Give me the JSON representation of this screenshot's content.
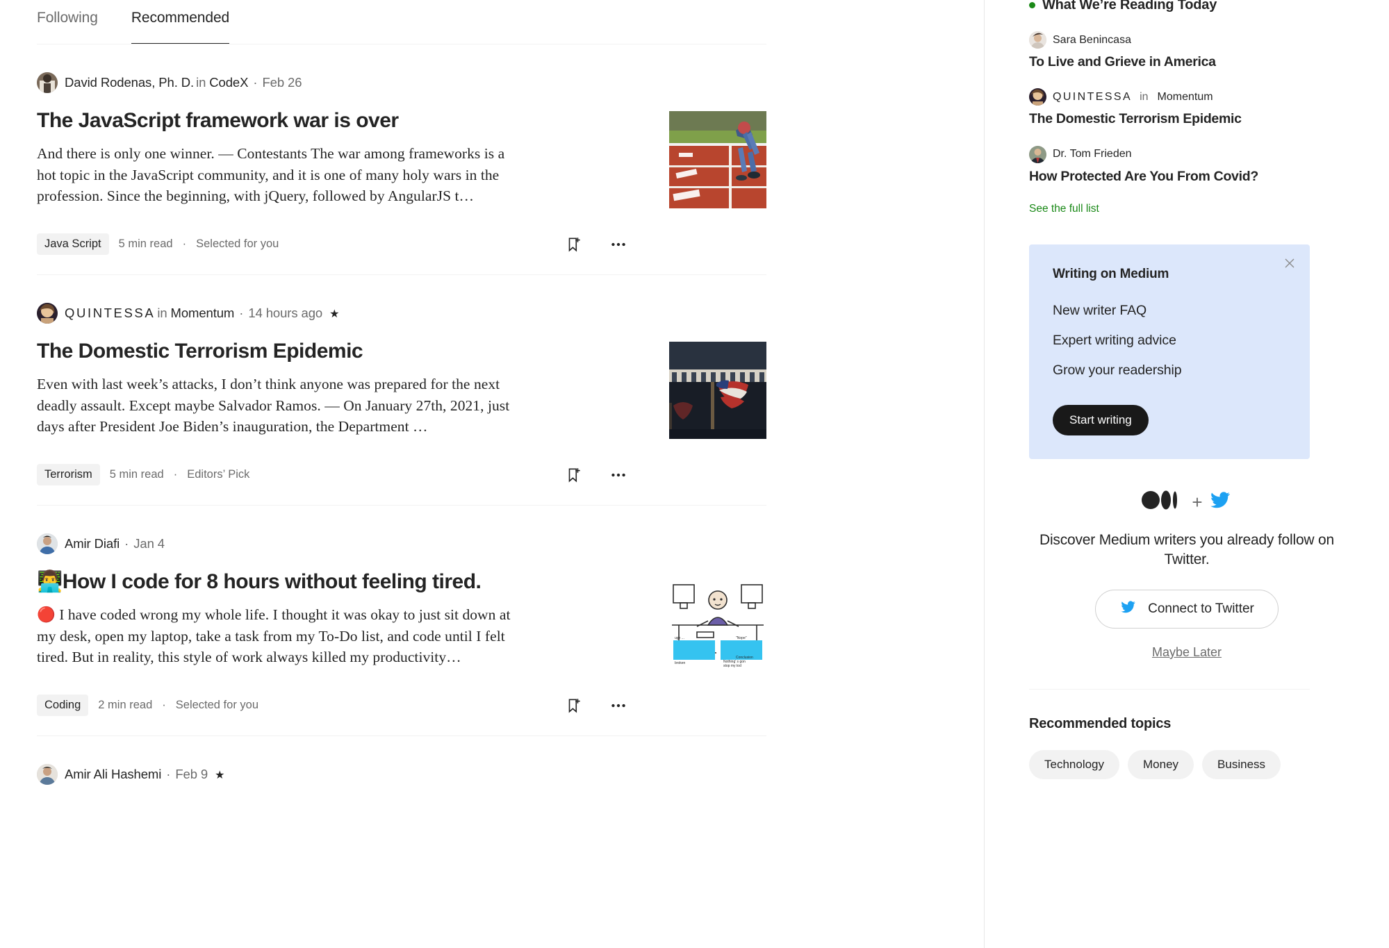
{
  "tabs": [
    {
      "label": "Following",
      "active": false
    },
    {
      "label": "Recommended",
      "active": true
    }
  ],
  "feed": {
    "articles": [
      {
        "author": "David Rodenas, Ph. D.",
        "author_spaced": false,
        "in_label": "in",
        "publication": "CodeX",
        "separator": "·",
        "date": "Feb 26",
        "starred": false,
        "star_glyph": "★",
        "title": "The JavaScript framework war is over",
        "title_emoji": "",
        "excerpt": "And there is only one winner. — Contestants The war among frameworks is a hot topic in the JavaScript community, and it is one of many holy wars in the profession. Since the beginning, with jQuery, followed by AngularJS t…",
        "tag": "Java Script",
        "read_time": "5 min read",
        "meta_dot": "·",
        "reason": "Selected for you",
        "thumb": "runner-on-track"
      },
      {
        "author": "QUINTESSA",
        "author_spaced": true,
        "in_label": "in",
        "publication": "Momentum",
        "separator": "·",
        "date": "14 hours ago",
        "starred": true,
        "star_glyph": "★",
        "title": "The Domestic Terrorism Epidemic",
        "title_emoji": "",
        "excerpt": "Even with last week’s attacks, I don’t think anyone was prepared for the next deadly assault. Except maybe Salvador Ramos. — On January 27th, 2021, just days after President Joe Biden’s inauguration, the Department …",
        "tag": "Terrorism",
        "read_time": "5 min read",
        "meta_dot": "·",
        "reason": "Editors’ Pick",
        "thumb": "american-flag-crowd"
      },
      {
        "author": "Amir Diafi",
        "author_spaced": false,
        "in_label": "",
        "publication": "",
        "separator": "·",
        "date": "Jan 4",
        "starred": false,
        "star_glyph": "★",
        "title": "How I code for 8 hours without feeling tired.",
        "title_emoji": "👨‍💻",
        "excerpt": "🔴 I have coded wrong my whole life. I thought it was okay to just sit down at my desk, open my laptop, take a task from my To-Do list, and code until I felt tired. But in reality, this style of work always killed my productivity…",
        "tag": "Coding",
        "read_time": "2 min read",
        "meta_dot": "·",
        "reason": "Selected for you",
        "thumb": "cartoon-at-desk"
      },
      {
        "author": "Amir Ali Hashemi",
        "author_spaced": false,
        "in_label": "",
        "publication": "",
        "separator": "·",
        "date": "Feb 9",
        "starred": true,
        "star_glyph": "★",
        "title": "",
        "title_emoji": "",
        "excerpt": "",
        "tag": "",
        "read_time": "",
        "meta_dot": "·",
        "reason": "",
        "thumb": ""
      }
    ],
    "icons": {
      "bookmark": "bookmark-add-icon",
      "more": "more-options-icon"
    }
  },
  "sidebar": {
    "reading_today": {
      "heading": "What We’re Reading Today",
      "items": [
        {
          "author": "Sara Benincasa",
          "author_spaced": false,
          "in_label": "",
          "publication": "",
          "title": "To Live and Grieve in America"
        },
        {
          "author": "QUINTESSA",
          "author_spaced": true,
          "in_label": "in",
          "publication": "Momentum",
          "title": "The Domestic Terrorism Epidemic"
        },
        {
          "author": "Dr. Tom Frieden",
          "author_spaced": false,
          "in_label": "",
          "publication": "",
          "title": "How Protected Are You From Covid?"
        }
      ],
      "see_full_list": "See the full list"
    },
    "promo": {
      "title": "Writing on Medium",
      "links": [
        "New writer FAQ",
        "Expert writing advice",
        "Grow your readership"
      ],
      "cta": "Start writing",
      "close_icon": "close-icon",
      "bg_color": "#dce7fb"
    },
    "twitter": {
      "plus": "+",
      "copy": "Discover Medium writers you already follow on Twitter.",
      "connect_label": "Connect to Twitter",
      "maybe_later": "Maybe Later",
      "brand_color": "#1da1f2"
    },
    "topics": {
      "heading": "Recommended topics",
      "items": [
        "Technology",
        "Money",
        "Business"
      ]
    }
  },
  "colors": {
    "accent_green": "#1a8917",
    "text_primary": "#242424",
    "text_secondary": "#6b6b6b"
  }
}
